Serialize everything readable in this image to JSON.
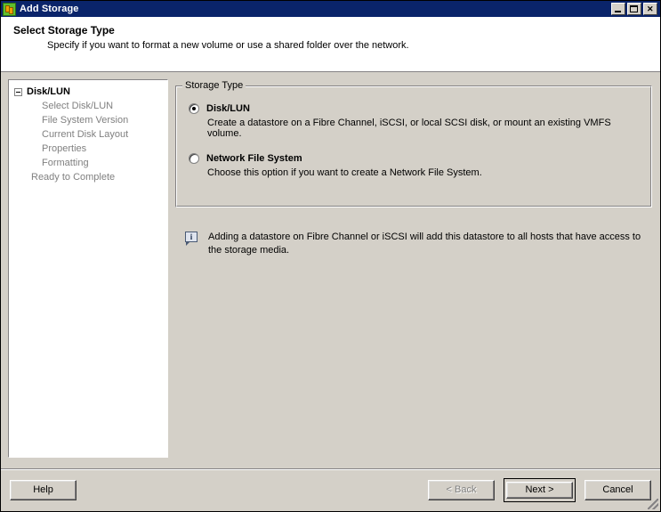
{
  "window": {
    "title": "Add Storage",
    "icon": "add-storage-icon",
    "controls": {
      "minimize": "Minimize",
      "maximize": "Maximize",
      "close": "Close"
    }
  },
  "header": {
    "title": "Select Storage Type",
    "subtitle": "Specify if you want to format a new volume or use a shared folder over the network."
  },
  "nav": {
    "root": {
      "label": "Disk/LUN",
      "expanded": true
    },
    "children": [
      {
        "label": "Select Disk/LUN"
      },
      {
        "label": "File System Version"
      },
      {
        "label": "Current Disk Layout"
      },
      {
        "label": "Properties"
      },
      {
        "label": "Formatting"
      }
    ],
    "tail": [
      {
        "label": "Ready to Complete"
      }
    ]
  },
  "group": {
    "legend": "Storage Type",
    "options": [
      {
        "label": "Disk/LUN",
        "description": "Create a datastore on a Fibre Channel, iSCSI, or local SCSI disk, or mount an existing VMFS volume.",
        "selected": true
      },
      {
        "label": "Network File System",
        "description": "Choose this option if you want to create a Network File System.",
        "selected": false
      }
    ]
  },
  "note": {
    "icon": "info-icon",
    "text": "Adding a datastore on Fibre Channel or iSCSI will add this datastore to all hosts that have access to the storage media."
  },
  "footer": {
    "help": "Help",
    "back": "< Back",
    "next": "Next >",
    "cancel": "Cancel"
  },
  "colors": {
    "titlebar": "#0a246a",
    "face": "#d4d0c8",
    "panel": "#ffffff",
    "disabled_text": "#808080"
  }
}
